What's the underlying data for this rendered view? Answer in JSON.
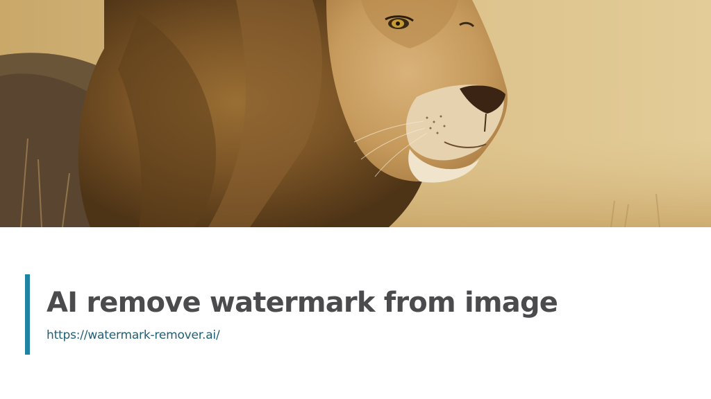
{
  "slide": {
    "image": {
      "alt": "lion"
    },
    "title": "AI remove watermark from image",
    "subtitle": "https://watermark-remover.ai/",
    "colors": {
      "accent": "#1f83a3",
      "title": "#4b4b4d",
      "subtitle": "#1f5f73",
      "background": "#ffffff"
    }
  }
}
